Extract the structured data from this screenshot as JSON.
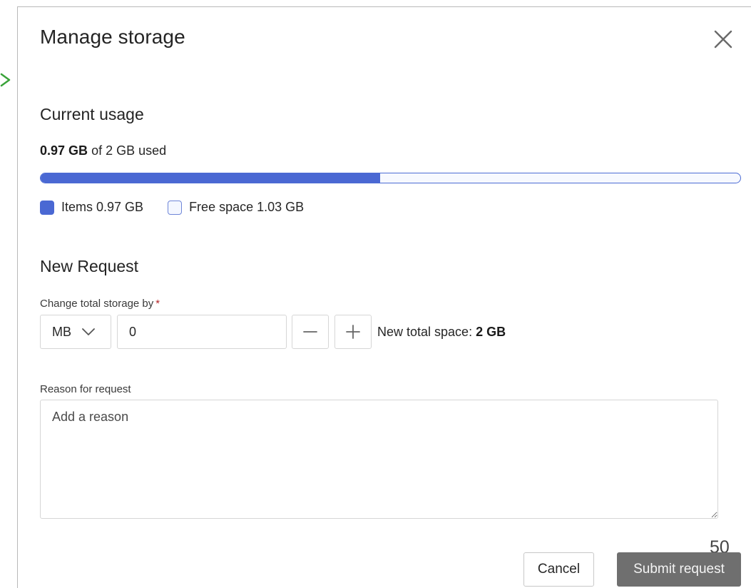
{
  "dialog": {
    "title": "Manage storage",
    "close_icon": "close-icon"
  },
  "usage": {
    "heading": "Current usage",
    "used_value": "0.97 GB",
    "used_suffix": "of 2 GB used",
    "used_fraction": 0.485,
    "legend": {
      "items_label": "Items 0.97 GB",
      "free_label": "Free space 1.03 GB"
    }
  },
  "request": {
    "heading": "New Request",
    "change_label": "Change total storage by",
    "required_marker": "*",
    "unit_selected": "MB",
    "amount_value": "0",
    "new_total_prefix": "New total space:",
    "new_total_value": "2 GB",
    "reason_label": "Reason for request",
    "reason_placeholder": "Add a reason",
    "char_count": "50"
  },
  "actions": {
    "cancel_label": "Cancel",
    "submit_label": "Submit request"
  },
  "colors": {
    "accent": "#4a68d3",
    "free_space": "#f4f7ff",
    "submit_bg": "#6f6f6f",
    "arrow": "#3aa33a",
    "required": "#b4262a"
  },
  "icons": {
    "close": "close-icon",
    "chevron": "chevron-down-icon",
    "minus": "minus-icon",
    "plus": "plus-icon",
    "arrow": "chevron-right-icon"
  }
}
